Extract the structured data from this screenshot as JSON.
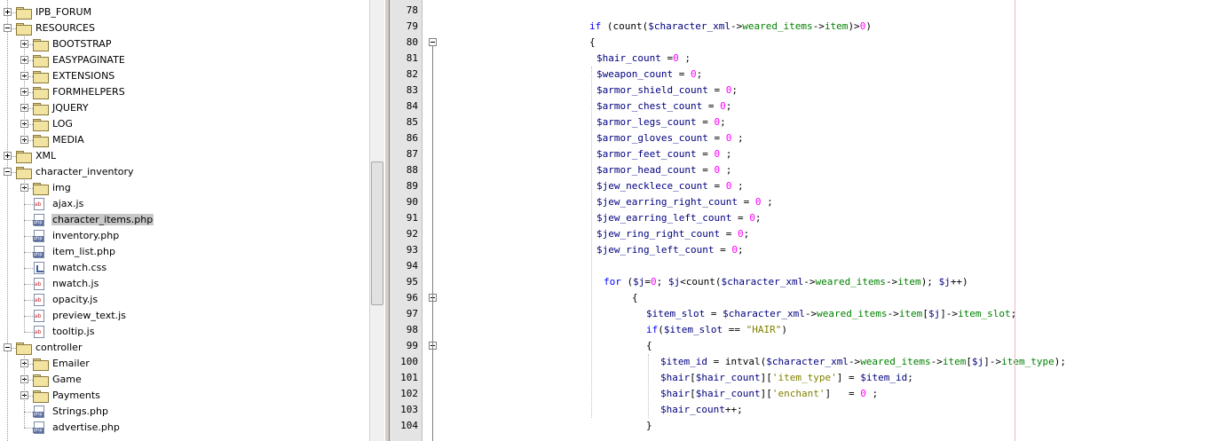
{
  "tree": {
    "items": [
      {
        "label": "IPB_FORUM",
        "type": "folder",
        "depth": 0,
        "expanded": false
      },
      {
        "label": "RESOURCES",
        "type": "folder",
        "depth": 0,
        "expanded": true
      },
      {
        "label": "BOOTSTRAP",
        "type": "folder",
        "depth": 1,
        "expanded": false
      },
      {
        "label": "EASYPAGINATE",
        "type": "folder",
        "depth": 1,
        "expanded": false
      },
      {
        "label": "EXTENSIONS",
        "type": "folder",
        "depth": 1,
        "expanded": false
      },
      {
        "label": "FORMHELPERS",
        "type": "folder",
        "depth": 1,
        "expanded": false
      },
      {
        "label": "JQUERY",
        "type": "folder",
        "depth": 1,
        "expanded": false
      },
      {
        "label": "LOG",
        "type": "folder",
        "depth": 1,
        "expanded": false
      },
      {
        "label": "MEDIA",
        "type": "folder",
        "depth": 1,
        "expanded": false
      },
      {
        "label": "XML",
        "type": "folder",
        "depth": 0,
        "expanded": false
      },
      {
        "label": "character_inventory",
        "type": "folder",
        "depth": 0,
        "expanded": true
      },
      {
        "label": "img",
        "type": "folder",
        "depth": 1,
        "expanded": false
      },
      {
        "label": "ajax.js",
        "type": "js",
        "depth": 1
      },
      {
        "label": "character_items.php",
        "type": "php",
        "depth": 1,
        "selected": true
      },
      {
        "label": "inventory.php",
        "type": "php",
        "depth": 1
      },
      {
        "label": "item_list.php",
        "type": "php",
        "depth": 1
      },
      {
        "label": "nwatch.css",
        "type": "css",
        "depth": 1
      },
      {
        "label": "nwatch.js",
        "type": "js",
        "depth": 1
      },
      {
        "label": "opacity.js",
        "type": "js",
        "depth": 1
      },
      {
        "label": "preview_text.js",
        "type": "js",
        "depth": 1
      },
      {
        "label": "tooltip.js",
        "type": "js",
        "depth": 1
      },
      {
        "label": "controller",
        "type": "folder",
        "depth": 0,
        "expanded": true
      },
      {
        "label": "Emailer",
        "type": "folder",
        "depth": 1,
        "expanded": false
      },
      {
        "label": "Game",
        "type": "folder",
        "depth": 1,
        "expanded": false
      },
      {
        "label": "Payments",
        "type": "folder",
        "depth": 1,
        "expanded": false
      },
      {
        "label": "Strings.php",
        "type": "php",
        "depth": 1
      },
      {
        "label": "advertise.php",
        "type": "php",
        "depth": 1
      }
    ]
  },
  "editor": {
    "lines": [
      {
        "n": "78",
        "indent": 0,
        "tokens": []
      },
      {
        "n": "79",
        "indent": 172,
        "tokens": [
          [
            "kw",
            "if"
          ],
          [
            "op",
            " (count("
          ],
          [
            "var",
            "$character_xml"
          ],
          [
            "op",
            "->"
          ],
          [
            "prop",
            "weared_items"
          ],
          [
            "op",
            "->"
          ],
          [
            "prop",
            "item"
          ],
          [
            "op",
            ")>"
          ],
          [
            "num",
            "0"
          ],
          [
            "op",
            ")"
          ]
        ]
      },
      {
        "n": "80",
        "indent": 172,
        "tokens": [
          [
            "op",
            "{"
          ]
        ]
      },
      {
        "n": "81",
        "indent": 180,
        "tokens": [
          [
            "var",
            "$hair_count"
          ],
          [
            "op",
            " ="
          ],
          [
            "num",
            "0"
          ],
          [
            "op",
            " ;"
          ]
        ]
      },
      {
        "n": "82",
        "indent": 180,
        "tokens": [
          [
            "var",
            "$weapon_count"
          ],
          [
            "op",
            " = "
          ],
          [
            "num",
            "0"
          ],
          [
            "op",
            ";"
          ]
        ]
      },
      {
        "n": "83",
        "indent": 180,
        "tokens": [
          [
            "var",
            "$armor_shield_count"
          ],
          [
            "op",
            " = "
          ],
          [
            "num",
            "0"
          ],
          [
            "op",
            ";"
          ]
        ]
      },
      {
        "n": "84",
        "indent": 180,
        "tokens": [
          [
            "var",
            "$armor_chest_count"
          ],
          [
            "op",
            " = "
          ],
          [
            "num",
            "0"
          ],
          [
            "op",
            ";"
          ]
        ]
      },
      {
        "n": "85",
        "indent": 180,
        "tokens": [
          [
            "var",
            "$armor_legs_count"
          ],
          [
            "op",
            " = "
          ],
          [
            "num",
            "0"
          ],
          [
            "op",
            ";"
          ]
        ]
      },
      {
        "n": "86",
        "indent": 180,
        "tokens": [
          [
            "var",
            "$armor_gloves_count"
          ],
          [
            "op",
            " = "
          ],
          [
            "num",
            "0"
          ],
          [
            "op",
            " ;"
          ]
        ]
      },
      {
        "n": "87",
        "indent": 180,
        "tokens": [
          [
            "var",
            "$armor_feet_count"
          ],
          [
            "op",
            " = "
          ],
          [
            "num",
            "0"
          ],
          [
            "op",
            " ;"
          ]
        ]
      },
      {
        "n": "88",
        "indent": 180,
        "tokens": [
          [
            "var",
            "$armor_head_count"
          ],
          [
            "op",
            " = "
          ],
          [
            "num",
            "0"
          ],
          [
            "op",
            " ;"
          ]
        ]
      },
      {
        "n": "89",
        "indent": 180,
        "tokens": [
          [
            "var",
            "$jew_necklece_count"
          ],
          [
            "op",
            " = "
          ],
          [
            "num",
            "0"
          ],
          [
            "op",
            " ;"
          ]
        ]
      },
      {
        "n": "90",
        "indent": 180,
        "tokens": [
          [
            "var",
            "$jew_earring_right_count"
          ],
          [
            "op",
            " = "
          ],
          [
            "num",
            "0"
          ],
          [
            "op",
            " ;"
          ]
        ]
      },
      {
        "n": "91",
        "indent": 180,
        "tokens": [
          [
            "var",
            "$jew_earring_left_count"
          ],
          [
            "op",
            " = "
          ],
          [
            "num",
            "0"
          ],
          [
            "op",
            ";"
          ]
        ]
      },
      {
        "n": "92",
        "indent": 180,
        "tokens": [
          [
            "var",
            "$jew_ring_right_count"
          ],
          [
            "op",
            " = "
          ],
          [
            "num",
            "0"
          ],
          [
            "op",
            ";"
          ]
        ]
      },
      {
        "n": "93",
        "indent": 180,
        "tokens": [
          [
            "var",
            "$jew_ring_left_count"
          ],
          [
            "op",
            " = "
          ],
          [
            "num",
            "0"
          ],
          [
            "op",
            ";"
          ]
        ]
      },
      {
        "n": "94",
        "indent": 0,
        "tokens": []
      },
      {
        "n": "95",
        "indent": 188,
        "tokens": [
          [
            "kw",
            "for"
          ],
          [
            "op",
            " ("
          ],
          [
            "var",
            "$j"
          ],
          [
            "op",
            "="
          ],
          [
            "num",
            "0"
          ],
          [
            "op",
            "; "
          ],
          [
            "var",
            "$j"
          ],
          [
            "op",
            "<count("
          ],
          [
            "var",
            "$character_xml"
          ],
          [
            "op",
            "->"
          ],
          [
            "prop",
            "weared_items"
          ],
          [
            "op",
            "->"
          ],
          [
            "prop",
            "item"
          ],
          [
            "op",
            "); "
          ],
          [
            "var",
            "$j"
          ],
          [
            "op",
            "++)"
          ]
        ]
      },
      {
        "n": "96",
        "indent": 220,
        "tokens": [
          [
            "op",
            "{"
          ]
        ]
      },
      {
        "n": "97",
        "indent": 236,
        "tokens": [
          [
            "var",
            "$item_slot"
          ],
          [
            "op",
            " = "
          ],
          [
            "var",
            "$character_xml"
          ],
          [
            "op",
            "->"
          ],
          [
            "prop",
            "weared_items"
          ],
          [
            "op",
            "->"
          ],
          [
            "prop",
            "item"
          ],
          [
            "op",
            "["
          ],
          [
            "var",
            "$j"
          ],
          [
            "op",
            "]->"
          ],
          [
            "prop",
            "item_slot"
          ],
          [
            "op",
            ";"
          ]
        ]
      },
      {
        "n": "98",
        "indent": 236,
        "tokens": [
          [
            "kw",
            "if"
          ],
          [
            "op",
            "("
          ],
          [
            "var",
            "$item_slot"
          ],
          [
            "op",
            " == "
          ],
          [
            "str",
            "\"HAIR\""
          ],
          [
            "op",
            ")"
          ]
        ]
      },
      {
        "n": "99",
        "indent": 236,
        "tokens": [
          [
            "op",
            "{"
          ]
        ]
      },
      {
        "n": "100",
        "indent": 252,
        "tokens": [
          [
            "var",
            "$item_id"
          ],
          [
            "op",
            " = intval("
          ],
          [
            "var",
            "$character_xml"
          ],
          [
            "op",
            "->"
          ],
          [
            "prop",
            "weared_items"
          ],
          [
            "op",
            "->"
          ],
          [
            "prop",
            "item"
          ],
          [
            "op",
            "["
          ],
          [
            "var",
            "$j"
          ],
          [
            "op",
            "]->"
          ],
          [
            "prop",
            "item_type"
          ],
          [
            "op",
            ");"
          ]
        ]
      },
      {
        "n": "101",
        "indent": 252,
        "tokens": [
          [
            "var",
            "$hair"
          ],
          [
            "op",
            "["
          ],
          [
            "var",
            "$hair_count"
          ],
          [
            "op",
            "]["
          ],
          [
            "str",
            "'item_type'"
          ],
          [
            "op",
            "] = "
          ],
          [
            "var",
            "$item_id"
          ],
          [
            "op",
            ";"
          ]
        ]
      },
      {
        "n": "102",
        "indent": 252,
        "tokens": [
          [
            "var",
            "$hair"
          ],
          [
            "op",
            "["
          ],
          [
            "var",
            "$hair_count"
          ],
          [
            "op",
            "]["
          ],
          [
            "str",
            "'enchant'"
          ],
          [
            "op",
            "]   = "
          ],
          [
            "num",
            "0"
          ],
          [
            "op",
            " ;"
          ]
        ]
      },
      {
        "n": "103",
        "indent": 252,
        "tokens": [
          [
            "var",
            "$hair_count"
          ],
          [
            "op",
            "++;"
          ]
        ]
      },
      {
        "n": "104",
        "indent": 236,
        "tokens": [
          [
            "op",
            "}"
          ]
        ]
      }
    ]
  }
}
